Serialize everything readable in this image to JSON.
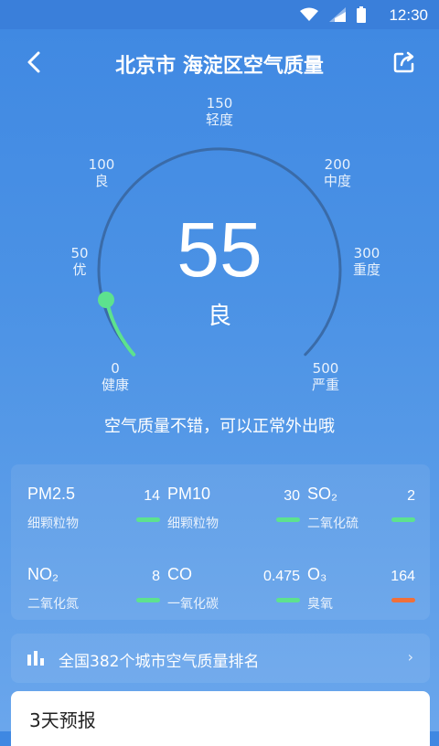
{
  "status_bar": {
    "time": "12:30"
  },
  "header": {
    "title": "北京市 海淀区空气质量"
  },
  "gauge": {
    "aqi": "55",
    "level": "良",
    "ticks": [
      {
        "value": "0",
        "label": "健康"
      },
      {
        "value": "50",
        "label": "优"
      },
      {
        "value": "100",
        "label": "良"
      },
      {
        "value": "150",
        "label": "轻度"
      },
      {
        "value": "200",
        "label": "中度"
      },
      {
        "value": "300",
        "label": "重度"
      },
      {
        "value": "500",
        "label": "严重"
      }
    ],
    "accent_color": "#5de28e"
  },
  "advice": "空气质量不错，可以正常外出哦",
  "pollutants": [
    {
      "name": "PM2.5",
      "desc": "细颗粒物",
      "value": "14",
      "color": "#5de28e"
    },
    {
      "name": "PM10",
      "desc": "细颗粒物",
      "value": "30",
      "color": "#5de28e"
    },
    {
      "name": "SO₂",
      "desc": "二氧化硫",
      "value": "2",
      "color": "#5de28e"
    },
    {
      "name": "NO₂",
      "desc": "二氧化氮",
      "value": "8",
      "color": "#5de28e"
    },
    {
      "name": "CO",
      "desc": "一氧化碳",
      "value": "0.475",
      "color": "#5de28e"
    },
    {
      "name": "O₃",
      "desc": "臭氧",
      "value": "164",
      "color": "#f0703a"
    }
  ],
  "ranking": {
    "label": "全国382个城市空气质量排名"
  },
  "forecast": {
    "title": "3天预报"
  }
}
